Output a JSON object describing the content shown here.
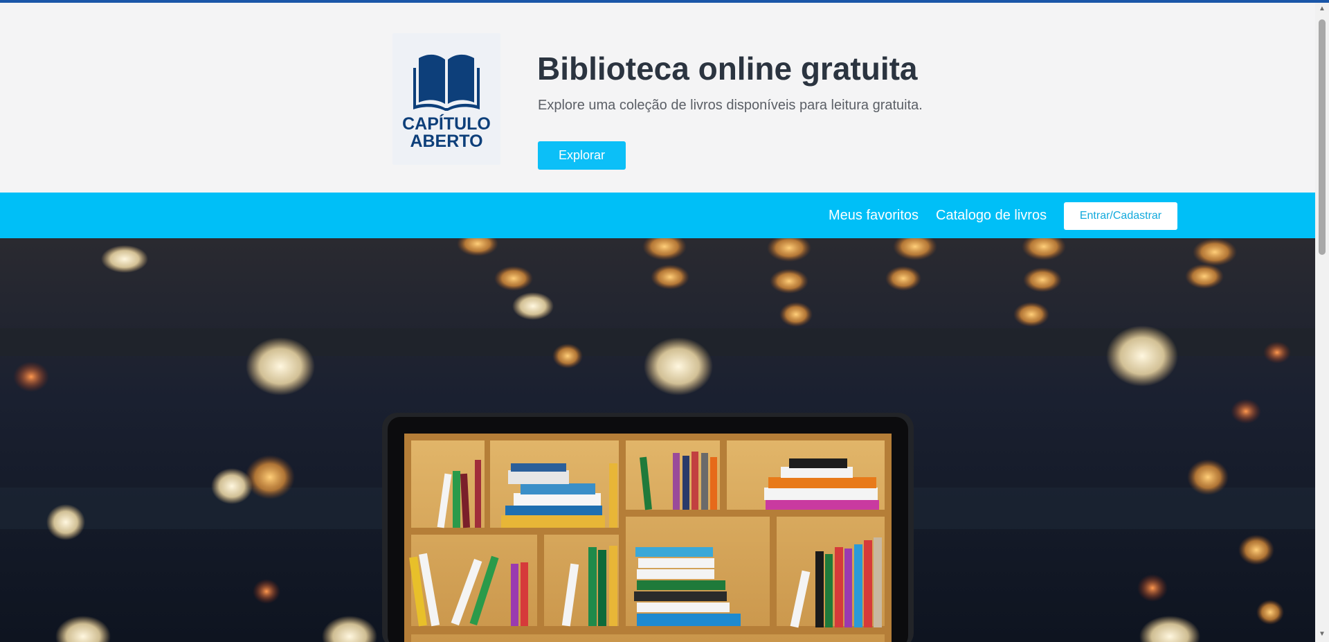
{
  "brand": {
    "logo_line1": "CAPÍTULO",
    "logo_line2": "ABERTO",
    "logo_color": "#0d3f7a"
  },
  "hero": {
    "title": "Biblioteca online gratuita",
    "subtitle": "Explore uma coleção de livros disponíveis para leitura gratuita.",
    "explore_label": "Explorar"
  },
  "nav": {
    "favorites": "Meus favoritos",
    "catalog": "Catalogo de livros",
    "login": "Entrar/Cadastrar"
  },
  "colors": {
    "accent": "#00bff7",
    "top_strip": "#1a56a8",
    "header_bg": "#f4f4f5",
    "title": "#2b3440"
  },
  "icons": {
    "logo": "open-book-icon",
    "scroll_up": "chevron-up-icon",
    "scroll_down": "chevron-down-icon"
  }
}
